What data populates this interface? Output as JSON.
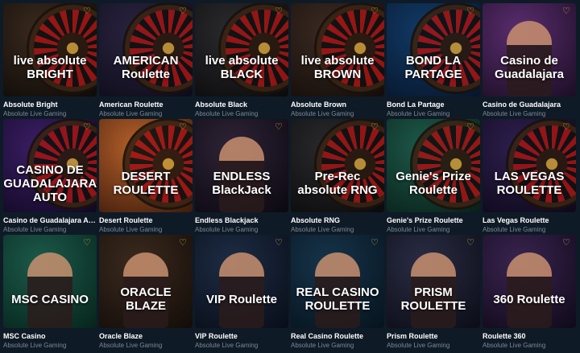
{
  "provider": "Absolute Live Gaming",
  "icons": {
    "favorite": "heart-icon"
  },
  "colors": {
    "background": "#0f1a27",
    "favorite": "#e0b64a",
    "provider_text": "#7d8896"
  },
  "games": [
    {
      "name": "Absolute Bright",
      "art": "live absolute BRIGHT",
      "bg": "#3a2a1d",
      "bg2": "#0d0a08",
      "kind": "wheel"
    },
    {
      "name": "American Roulette",
      "art": "AMERICAN Roulette",
      "bg": "#2a2440",
      "bg2": "#0c0b18",
      "kind": "wheel"
    },
    {
      "name": "Absolute Black",
      "art": "live absolute BLACK",
      "bg": "#2b2b2e",
      "bg2": "#0a0a0b",
      "kind": "wheel"
    },
    {
      "name": "Absolute Brown",
      "art": "live absolute BROWN",
      "bg": "#3b2a22",
      "bg2": "#120c09",
      "kind": "wheel"
    },
    {
      "name": "Bond La Partage",
      "art": "BOND LA PARTAGE",
      "bg": "#123a66",
      "bg2": "#06152a",
      "kind": "wheel"
    },
    {
      "name": "Casino de Guadalajara",
      "art": "Casino de Guadalajara",
      "bg": "#5a2d6e",
      "bg2": "#1b0d24",
      "kind": "person"
    },
    {
      "name": "Casino de Guadalajara Auto",
      "art": "CASINO DE GUADALAJARA AUTO",
      "bg": "#3b1e66",
      "bg2": "#100822",
      "kind": "wheel"
    },
    {
      "name": "Desert Roulette",
      "art": "DESERT ROULETTE",
      "bg": "#b5602a",
      "bg2": "#3c1a0b",
      "kind": "wheel"
    },
    {
      "name": "Endless Blackjack",
      "art": "ENDLESS BlackJack",
      "bg": "#2e2336",
      "bg2": "#0b0810",
      "kind": "person"
    },
    {
      "name": "Absolute RNG",
      "art": "Pre-Rec absolute RNG",
      "bg": "#2a2a2d",
      "bg2": "#0a0a0b",
      "kind": "wheel"
    },
    {
      "name": "Genie's Prize Roulette",
      "art": "Genie's Prize Roulette",
      "bg": "#1d5a4a",
      "bg2": "#081f18",
      "kind": "wheel"
    },
    {
      "name": "Las Vegas Roulette",
      "art": "LAS VEGAS ROULETTE",
      "bg": "#2f1f4f",
      "bg2": "#0c0818",
      "kind": "wheel"
    },
    {
      "name": "MSC Casino",
      "art": "MSC CASINO",
      "bg": "#1c5a4a",
      "bg2": "#06241c",
      "kind": "person"
    },
    {
      "name": "Oracle Blaze",
      "art": "ORACLE BLAZE",
      "bg": "#3b2a1e",
      "bg2": "#120c08",
      "kind": "person"
    },
    {
      "name": "VIP Roulette",
      "art": "VIP Roulette",
      "bg": "#1d2c44",
      "bg2": "#080d18",
      "kind": "person"
    },
    {
      "name": "Real Casino Roulette",
      "art": "REAL CASINO ROULETTE",
      "bg": "#16344a",
      "bg2": "#06131d",
      "kind": "person"
    },
    {
      "name": "Prism Roulette",
      "art": "PRISM ROULETTE",
      "bg": "#2a2d44",
      "bg2": "#0b0c16",
      "kind": "person"
    },
    {
      "name": "Roulette 360",
      "art": "360 Roulette",
      "bg": "#3a2450",
      "bg2": "#0f0919",
      "kind": "person"
    }
  ]
}
